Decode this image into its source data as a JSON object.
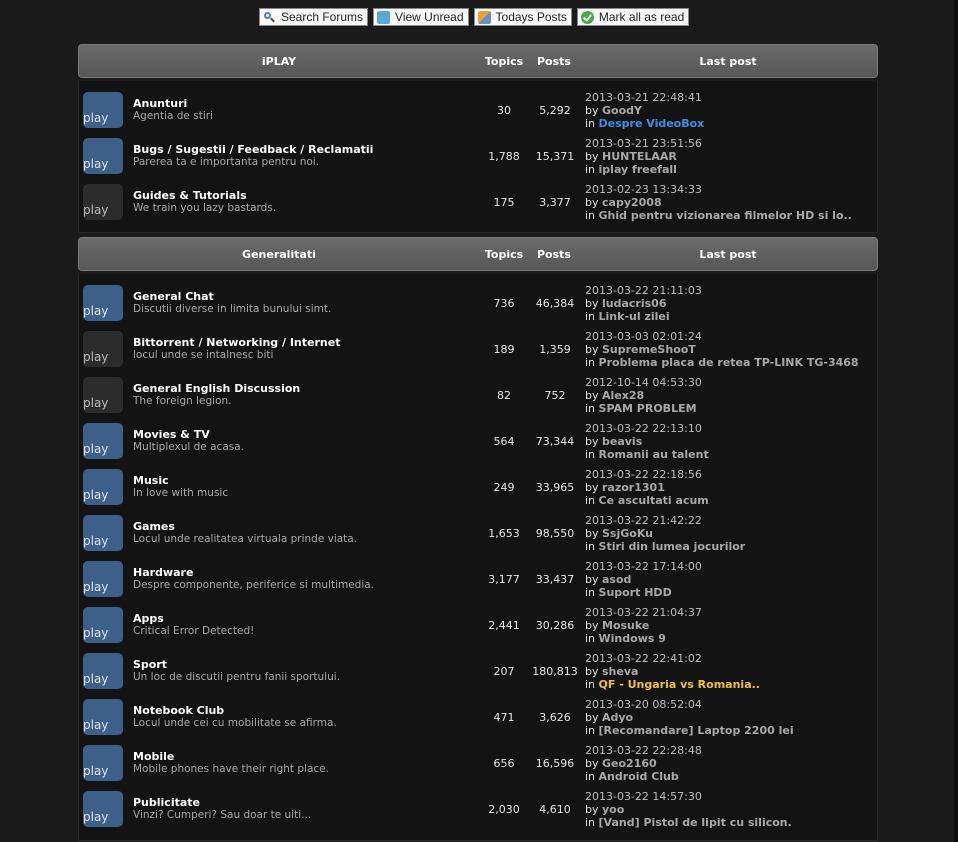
{
  "toolbar": [
    {
      "label": "Search Forums",
      "icon": "search-icon"
    },
    {
      "label": "View Unread",
      "icon": "speech-bubble-icon"
    },
    {
      "label": "Todays Posts",
      "icon": "posts-icon"
    },
    {
      "label": "Mark all as read",
      "icon": "mark-read-icon"
    }
  ],
  "categories": [
    {
      "title": "iPLAY",
      "col_topics": "Topics",
      "col_posts": "Posts",
      "col_last": "Last post",
      "forums": [
        {
          "icon": "play",
          "name": "Anunturi",
          "desc": "Agentia de stiri",
          "topics": "30",
          "posts": "5,292",
          "date": "2013-03-21 22:48:41",
          "by": "by",
          "user": "GoodY",
          "in": "in",
          "topic": "Despre VideoBox",
          "topic_color": "#3b8fe6",
          "user_color": "#a8a8a8",
          "icon_state": "new"
        },
        {
          "icon": "play",
          "name": "Bugs / Sugestii / Feedback / Reclamatii",
          "desc": "Parerea ta e importanta pentru noi.",
          "topics": "1,788",
          "posts": "15,371",
          "date": "2013-03-21 23:51:56",
          "by": "by",
          "user": "HUNTELAAR",
          "in": "in",
          "topic": "iplay freefall",
          "topic_color": "#a8a8a8",
          "user_color": "#a8a8a8",
          "icon_state": "new"
        },
        {
          "icon": "play",
          "name": "Guides & Tutorials",
          "desc": "We train you lazy bastards.",
          "topics": "175",
          "posts": "3,377",
          "date": "2013-02-23 13:34:33",
          "by": "by",
          "user": "capy2008",
          "in": "in",
          "topic": "Ghid pentru vizionarea filmelor HD si lo..",
          "topic_color": "#a8a8a8",
          "user_color": "#a8a8a8",
          "icon_state": "old"
        }
      ]
    },
    {
      "title": "Generalitati",
      "col_topics": "Topics",
      "col_posts": "Posts",
      "col_last": "Last post",
      "forums": [
        {
          "icon": "play",
          "name": "General Chat",
          "desc": "Discutii diverse in limita bunului simt.",
          "topics": "736",
          "posts": "46,384",
          "date": "2013-03-22 21:11:03",
          "by": "by",
          "user": "ludacris06",
          "in": "in",
          "topic": "Link-ul zilei",
          "topic_color": "#a8a8a8",
          "user_color": "#a8a8a8",
          "icon_state": "new"
        },
        {
          "icon": "play",
          "name": "Bittorrent / Networking / Internet",
          "desc": "locul unde se intalnesc biti",
          "topics": "189",
          "posts": "1,359",
          "date": "2013-03-03 02:01:24",
          "by": "by",
          "user": "SupremeShooT",
          "in": "in",
          "topic": "Problema placa de retea TP-LINK TG-3468",
          "topic_color": "#a8a8a8",
          "user_color": "#a8a8a8",
          "icon_state": "old"
        },
        {
          "icon": "play",
          "name": "General English Discussion",
          "desc": "The foreign legion.",
          "topics": "82",
          "posts": "752",
          "date": "2012-10-14 04:53:30",
          "by": "by",
          "user": "Alex28",
          "in": "in",
          "topic": "SPAM PROBLEM",
          "topic_color": "#a8a8a8",
          "user_color": "#a8a8a8",
          "icon_state": "old"
        },
        {
          "icon": "play",
          "name": "Movies & TV",
          "desc": "Multiplexul de acasa.",
          "topics": "564",
          "posts": "73,344",
          "date": "2013-03-22 22:13:10",
          "by": "by",
          "user": "beavis",
          "in": "in",
          "topic": "Romanii au talent",
          "topic_color": "#a8a8a8",
          "user_color": "#a8a8a8",
          "icon_state": "new"
        },
        {
          "icon": "play",
          "name": "Music",
          "desc": "In love with music",
          "topics": "249",
          "posts": "33,965",
          "date": "2013-03-22 22:18:56",
          "by": "by",
          "user": "razor1301",
          "in": "in",
          "topic": "Ce ascultati acum",
          "topic_color": "#a8a8a8",
          "user_color": "#a8a8a8",
          "icon_state": "new"
        },
        {
          "icon": "play",
          "name": "Games",
          "desc": "Locul unde realitatea virtuala prinde viata.",
          "topics": "1,653",
          "posts": "98,550",
          "date": "2013-03-22 21:42:22",
          "by": "by",
          "user": "SsjGoKu",
          "in": "in",
          "topic": "Stiri din lumea jocurilor",
          "topic_color": "#a8a8a8",
          "user_color": "#a8a8a8",
          "icon_state": "new"
        },
        {
          "icon": "play",
          "name": "Hardware",
          "desc": "Despre componente, periferice si multimedia.",
          "topics": "3,177",
          "posts": "33,437",
          "date": "2013-03-22 17:14:00",
          "by": "by",
          "user": "asod",
          "in": "in",
          "topic": "Suport HDD",
          "topic_color": "#a8a8a8",
          "user_color": "#a8a8a8",
          "icon_state": "new"
        },
        {
          "icon": "play",
          "name": "Apps",
          "desc": "Critical Error Detected!",
          "topics": "2,441",
          "posts": "30,286",
          "date": "2013-03-22 21:04:37",
          "by": "by",
          "user": "Mosuke",
          "in": "in",
          "topic": "Windows 9",
          "topic_color": "#a8a8a8",
          "user_color": "#a8a8a8",
          "icon_state": "new"
        },
        {
          "icon": "play",
          "name": "Sport",
          "desc": "Un loc de discutii pentru fanii sportului.",
          "topics": "207",
          "posts": "180,813",
          "date": "2013-03-22 22:41:02",
          "by": "by",
          "user": "sheva",
          "in": "in",
          "topic": "QF - Ungaria vs Romania..",
          "topic_color": "#f2c12e",
          "user_color": "#a8a8a8",
          "icon_state": "new"
        },
        {
          "icon": "play",
          "name": "Notebook Club",
          "desc": "Locul unde cei cu mobilitate se afirma.",
          "topics": "471",
          "posts": "3,626",
          "date": "2013-03-20 08:52:04",
          "by": "by",
          "user": "Adyo",
          "in": "in",
          "topic": "[Recomandare] Laptop 2200 lei",
          "topic_color": "#a8a8a8",
          "user_color": "#a8a8a8",
          "icon_state": "new"
        },
        {
          "icon": "play",
          "name": "Mobile",
          "desc": "Mobile phones have their right place.",
          "topics": "656",
          "posts": "16,596",
          "date": "2013-03-22 22:28:48",
          "by": "by",
          "user": "Geo2160",
          "in": "in",
          "topic": "Android Club",
          "topic_color": "#a8a8a8",
          "user_color": "#a8a8a8",
          "icon_state": "new"
        },
        {
          "icon": "play",
          "name": "Publicitate",
          "desc": "Vinzi? Cumperi? Sau doar te uiti...",
          "topics": "2,030",
          "posts": "4,610",
          "date": "2013-03-22 14:57:30",
          "by": "by",
          "user": "yoo",
          "in": "in",
          "topic": "[Vand] Pistol de lipit cu silicon.",
          "topic_color": "#a8a8a8",
          "user_color": "#a8a8a8",
          "icon_state": "new"
        }
      ]
    }
  ]
}
